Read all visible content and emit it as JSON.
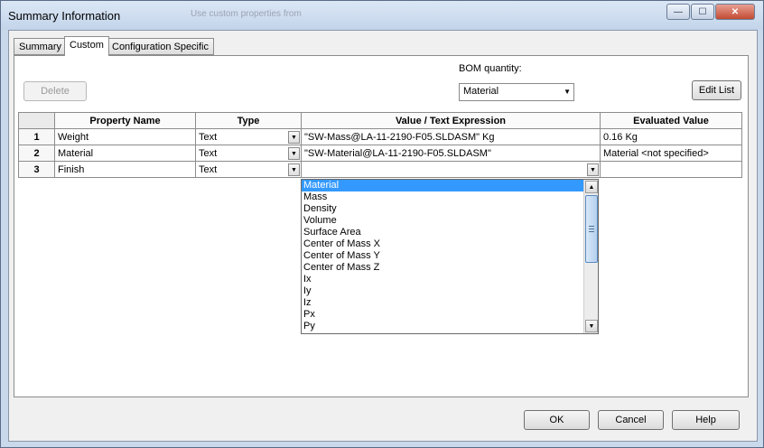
{
  "window": {
    "title": "Summary Information",
    "background_caption": "Use custom properties from",
    "minimize": "—",
    "maximize": "☐",
    "close": "✕"
  },
  "tabs": [
    {
      "label": "Summary"
    },
    {
      "label": "Custom"
    },
    {
      "label": "Configuration Specific"
    }
  ],
  "toolbar": {
    "delete_label": "Delete",
    "bom_label": "BOM quantity:",
    "bom_value": "Material",
    "edit_list_label": "Edit List"
  },
  "table": {
    "headers": [
      "Property Name",
      "Type",
      "Value / Text Expression",
      "Evaluated Value"
    ],
    "rows": [
      {
        "num": "1",
        "name": "Weight",
        "type": "Text",
        "value": "\"SW-Mass@LA-11-2190-F05.SLDASM\" Kg",
        "evaluated": "0.16 Kg"
      },
      {
        "num": "2",
        "name": "Material",
        "type": "Text",
        "value": "\"SW-Material@LA-11-2190-F05.SLDASM\"",
        "evaluated": "Material <not specified>"
      },
      {
        "num": "3",
        "name": "Finish",
        "type": "Text",
        "value": "",
        "evaluated": ""
      }
    ]
  },
  "dropdown": {
    "items": [
      "Material",
      "Mass",
      "Density",
      "Volume",
      "Surface Area",
      "Center of Mass X",
      "Center of Mass Y",
      "Center of Mass Z",
      "Ix",
      "Iy",
      "Iz",
      "Px",
      "Py"
    ],
    "selected": "Material",
    "scroll_position": 0.0
  },
  "footer": {
    "ok_label": "OK",
    "cancel_label": "Cancel",
    "help_label": "Help"
  },
  "colors": {
    "selection": "#3399ff",
    "titlebar": "#c9d8ea"
  }
}
